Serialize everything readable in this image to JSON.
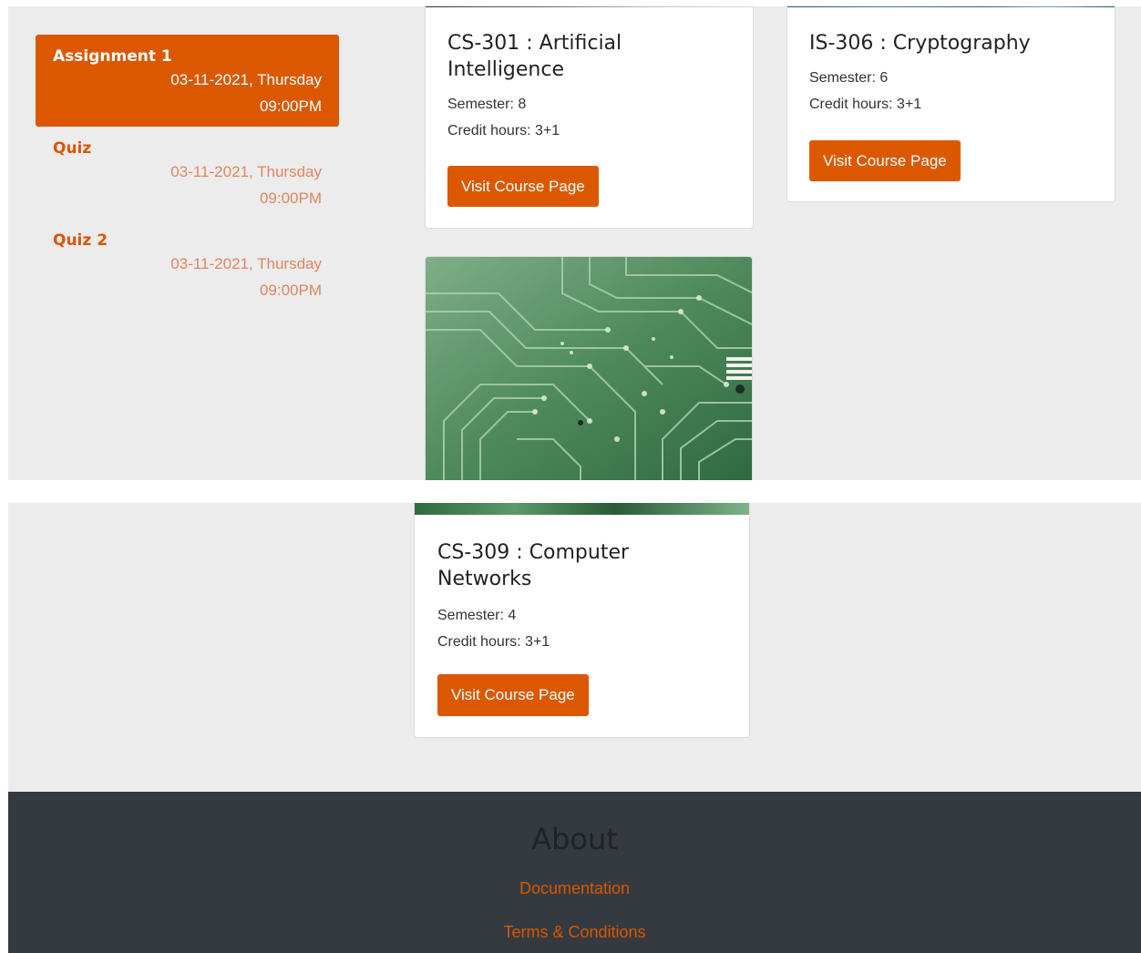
{
  "upcoming": {
    "items": [
      {
        "title": "Assignment 1",
        "date": "03-11-2021, Thursday",
        "time": "09:00PM",
        "active": true
      },
      {
        "title": "Quiz",
        "date": "03-11-2021, Thursday",
        "time": "09:00PM",
        "active": false
      },
      {
        "title": "Quiz 2",
        "date": "03-11-2021, Thursday",
        "time": "09:00PM",
        "active": false
      }
    ]
  },
  "courses": [
    {
      "title": "CS-301 : Artificial Intelligence",
      "semester": "Semester: 8",
      "credit": "Credit hours: 3+1",
      "button": "Visit Course Page"
    },
    {
      "title": "IS-306 : Cryptography",
      "semester": "Semester: 6",
      "credit": "Credit hours: 3+1",
      "button": "Visit Course Page"
    },
    {
      "title": "CS-309 : Computer Networks",
      "semester": "Semester: 4",
      "credit": "Credit hours: 3+1",
      "button": "Visit Course Page"
    }
  ],
  "footer": {
    "title": "About",
    "links": [
      "Documentation",
      "Terms & Conditions"
    ]
  },
  "colors": {
    "accent": "#dc5800",
    "footer_bg": "#343a40",
    "page_bg": "#ececec"
  }
}
